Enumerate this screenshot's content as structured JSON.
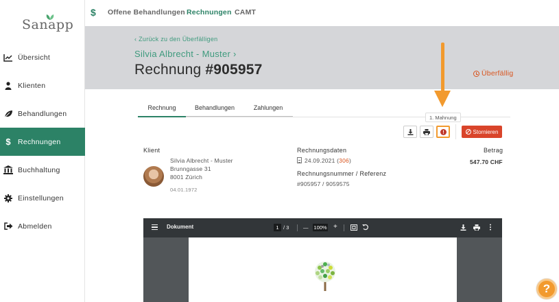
{
  "app": {
    "logo_text": "Sanapp"
  },
  "sidebar": {
    "items": [
      {
        "label": "Übersicht",
        "icon": "chart-line-icon"
      },
      {
        "label": "Klienten",
        "icon": "user-icon"
      },
      {
        "label": "Behandlungen",
        "icon": "leaf-icon"
      },
      {
        "label": "Rechnungen",
        "icon": "dollar-icon",
        "active": true
      },
      {
        "label": "Buchhaltung",
        "icon": "bank-icon"
      },
      {
        "label": "Einstellungen",
        "icon": "gear-icon"
      },
      {
        "label": "Abmelden",
        "icon": "logout-icon"
      }
    ]
  },
  "topnav": {
    "links": [
      "Offene Behandlungen",
      "Rechnungen",
      "CAMT"
    ],
    "active": "Rechnungen"
  },
  "header": {
    "back_link": "‹ Zurück zu den Überfälligen",
    "patient_link": "Silvia Albrecht - Muster ›",
    "title_prefix": "Rechnung ",
    "title_number": "#905957",
    "status": "Überfällig"
  },
  "tabs": [
    "Rechnung",
    "Behandlungen",
    "Zahlungen"
  ],
  "actions": {
    "tooltip": "1. Mahnung",
    "cancel_label": "Stornieren"
  },
  "client": {
    "label": "Klient",
    "name": "Silvia Albrecht - Muster",
    "street": "Brunngasse 31",
    "city": "8001 Zürich",
    "birthdate": "04.01.1972"
  },
  "invoice": {
    "dates_label": "Rechnungsdaten",
    "date": "24.09.2021",
    "days_prefix": "(",
    "days": "306",
    "days_suffix": ")",
    "ref_label": "Rechnungsnummer / Referenz",
    "ref": "#905957 / 9059575",
    "amount_label": "Betrag",
    "amount": "547.70 CHF"
  },
  "pdf": {
    "title": "Dokument",
    "page": "1",
    "pages": "/ 3",
    "zoom": "100%",
    "minus": "—",
    "plus": "+"
  },
  "help": {
    "label": "?"
  },
  "colors": {
    "brand": "#2c8266",
    "accent": "#f29a2e",
    "danger": "#d9442a"
  }
}
